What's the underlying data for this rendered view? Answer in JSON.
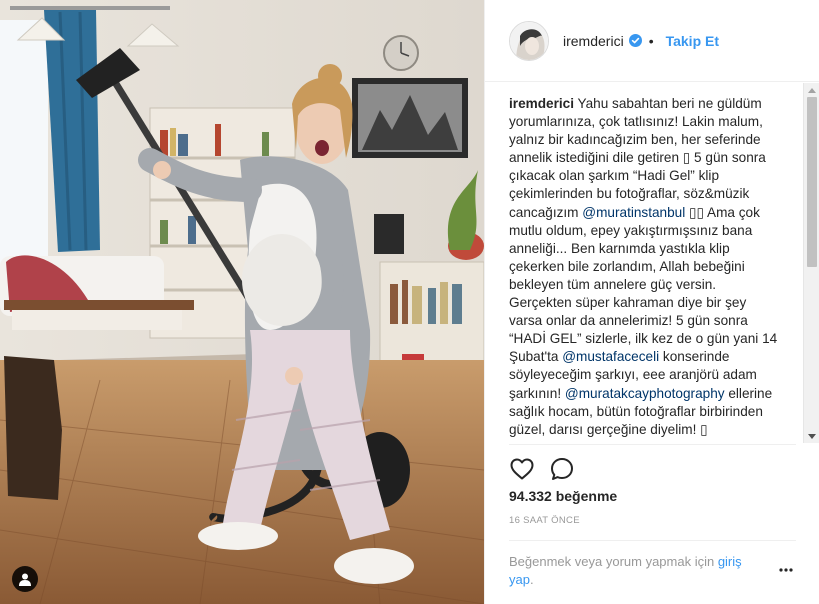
{
  "post": {
    "author": {
      "username": "iremderici",
      "verified": true,
      "follow_label": "Takip Et",
      "separator": "•"
    },
    "caption": {
      "username": "iremderici",
      "lines": [
        [
          {
            "t": "Yahu sabahtan beri ne güldüm"
          }
        ],
        [
          {
            "t": "yorumlarınıza, çok tatlısınız! Lakin malum,"
          }
        ],
        [
          {
            "t": "yalnız bir kadıncağızim ben, her seferinde"
          }
        ],
        [
          {
            "t": "annelik istediğini dile getiren ▯ 5 gün sonra"
          }
        ],
        [
          {
            "t": "çıkacak olan şarkım “Hadi Gel” klip"
          }
        ],
        [
          {
            "t": "çekimlerinden bu fotoğraflar, söz&müzik"
          }
        ],
        [
          {
            "t": "cancağızım "
          },
          {
            "t": "@muratinstanbul",
            "m": true
          },
          {
            "t": " ▯▯ Ama çok"
          }
        ],
        [
          {
            "t": "mutlu oldum, epey yakıştırmışsınız bana"
          }
        ],
        [
          {
            "t": "anneliği... Ben karnımda yastıkla klip"
          }
        ],
        [
          {
            "t": "çekerken bile zorlandım, Allah bebeğini"
          }
        ],
        [
          {
            "t": "bekleyen tüm annelere güç versin."
          }
        ],
        [
          {
            "t": "Gerçekten süper kahraman diye bir şey"
          }
        ],
        [
          {
            "t": "varsa onlar da annelerimiz! 5 gün sonra"
          }
        ],
        [
          {
            "t": "“HADİ GEL” sizlerle, ilk kez de o gün yani 14"
          }
        ],
        [
          {
            "t": "Şubat'ta "
          },
          {
            "t": "@mustafaceceli",
            "m": true
          },
          {
            "t": " konserinde"
          }
        ],
        [
          {
            "t": "söyleyeceğim şarkıyı, eee aranjörü adam"
          }
        ],
        [
          {
            "t": "şarkının! "
          },
          {
            "t": "@muratakcayphotography",
            "m": true
          },
          {
            "t": " ellerine"
          }
        ],
        [
          {
            "t": "sağlık hocam, bütün fotoğraflar birbirinden"
          }
        ],
        [
          {
            "t": "güzel, darısı gerçeğine diyelim! ▯"
          }
        ]
      ]
    },
    "likes": "94.332 beğenme",
    "time": "16 SAAT ÖNCE",
    "login_prompt": {
      "text": "Beğenmek veya yorum yapmak için ",
      "link": "giriş yap",
      "end": "."
    }
  },
  "icons": {
    "verified": "verified-badge-icon",
    "like": "heart-icon",
    "comment": "comment-bubble-icon",
    "more": "more-options-icon",
    "tagged_users": "user-tag-icon"
  },
  "colors": {
    "link": "#3897f0",
    "mention": "#003569",
    "muted": "#999999",
    "text": "#262626",
    "border": "#efefef"
  }
}
